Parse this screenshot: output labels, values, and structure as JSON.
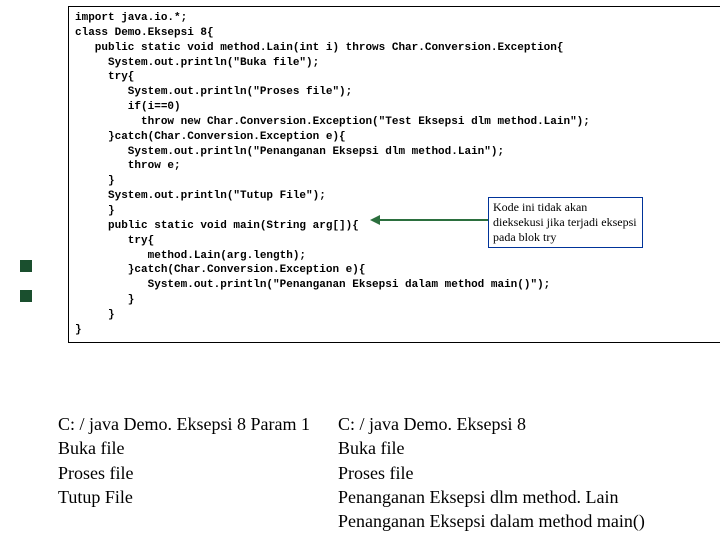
{
  "code": {
    "l01": "import java.io.*;",
    "l02": "class Demo.Eksepsi 8{",
    "l03": "   public static void method.Lain(int i) throws Char.Conversion.Exception{",
    "l04": "     System.out.println(\"Buka file\");",
    "l05": "     try{",
    "l06": "        System.out.println(\"Proses file\");",
    "l07": "        if(i==0)",
    "l08": "          throw new Char.Conversion.Exception(\"Test Eksepsi dlm method.Lain\");",
    "l09": "     }catch(Char.Conversion.Exception e){",
    "l10": "        System.out.println(\"Penanganan Eksepsi dlm method.Lain\");",
    "l11": "        throw e;",
    "l12": "     }",
    "l13": "     System.out.println(\"Tutup File\");",
    "l14": "     }",
    "l15": "     public static void main(String arg[]){",
    "l16": "        try{",
    "l17": "           method.Lain(arg.length);",
    "l18": "        }catch(Char.Conversion.Exception e){",
    "l19": "           System.out.println(\"Penanganan Eksepsi dalam method main()\");",
    "l20": "        }",
    "l21": "     }",
    "l22": "}"
  },
  "callout": {
    "text": "Kode ini tidak akan dieksekusi jika terjadi eksepsi pada blok try"
  },
  "output_left": {
    "l1": "C: / java Demo. Eksepsi 8 Param 1",
    "l2": "Buka file",
    "l3": "Proses file",
    "l4": "Tutup File"
  },
  "output_right": {
    "l1": "C: / java Demo. Eksepsi 8",
    "l2": "Buka file",
    "l3": "Proses file",
    "l4": "Penanganan Eksepsi dlm method. Lain",
    "l5": "Penanganan Eksepsi dalam method main()"
  }
}
